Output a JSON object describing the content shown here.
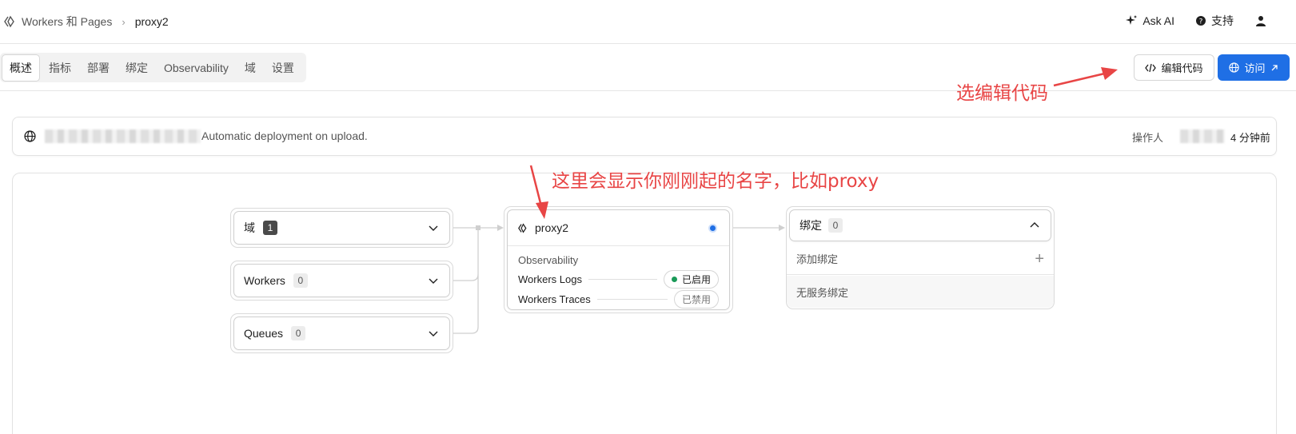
{
  "breadcrumb": {
    "parent": "Workers 和 Pages",
    "current": "proxy2"
  },
  "topbar": {
    "ask_ai": "Ask AI",
    "support": "支持"
  },
  "tabs": [
    {
      "label": "概述",
      "active": true
    },
    {
      "label": "指标"
    },
    {
      "label": "部署"
    },
    {
      "label": "绑定"
    },
    {
      "label": "Observability"
    },
    {
      "label": "域"
    },
    {
      "label": "设置"
    }
  ],
  "actions": {
    "edit_code": "编辑代码",
    "visit": "访问"
  },
  "deployment": {
    "description": "Automatic deployment on upload.",
    "operator_label": "操作人",
    "time": "4 分钟前"
  },
  "resources": [
    {
      "label": "域",
      "count": "1"
    },
    {
      "label": "Workers",
      "count": "0"
    },
    {
      "label": "Queues",
      "count": "0"
    }
  ],
  "worker": {
    "name": "proxy2",
    "observability_title": "Observability",
    "logs_label": "Workers Logs",
    "logs_status": "已启用",
    "traces_label": "Workers Traces",
    "traces_status": "已禁用"
  },
  "bindings": {
    "label": "绑定",
    "count": "0",
    "add_label": "添加绑定",
    "empty_label": "无服务绑定"
  },
  "annotations": {
    "edit_hint": "选编辑代码",
    "name_hint": "这里会显示你刚刚起的名字，比如proxy"
  },
  "colors": {
    "accent": "#1f6fe5",
    "annotation": "#e84545",
    "enabled": "#1a9a58"
  }
}
